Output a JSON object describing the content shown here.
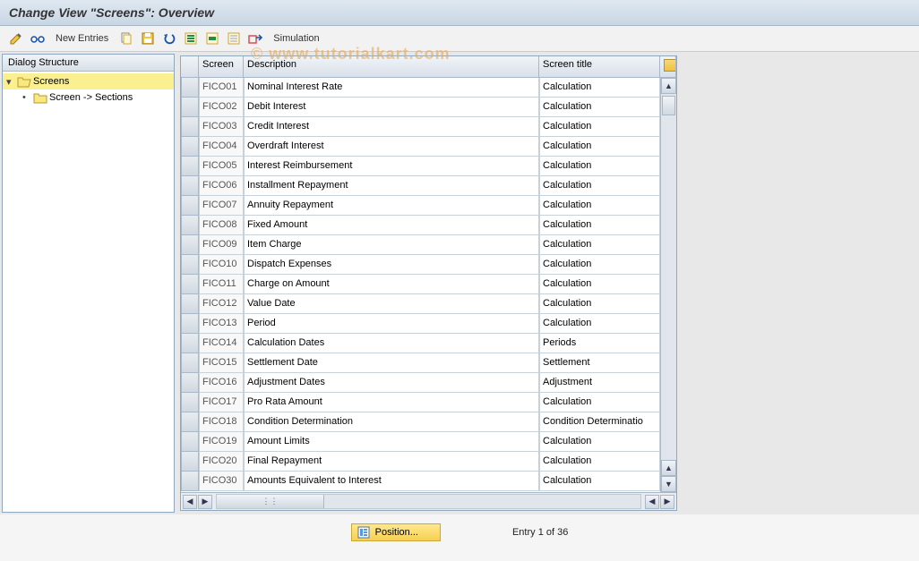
{
  "title": "Change View \"Screens\": Overview",
  "watermark": "© www.tutorialkart.com",
  "toolbar": {
    "new_entries": "New Entries",
    "simulation": "Simulation"
  },
  "sidebar": {
    "header": "Dialog Structure",
    "root": "Screens",
    "child": "Screen -> Sections"
  },
  "table": {
    "headers": {
      "screen": "Screen",
      "description": "Description",
      "title": "Screen title"
    },
    "rows": [
      {
        "screen": "FICO01",
        "desc": "Nominal Interest Rate",
        "title": "Calculation"
      },
      {
        "screen": "FICO02",
        "desc": "Debit Interest",
        "title": "Calculation"
      },
      {
        "screen": "FICO03",
        "desc": "Credit Interest",
        "title": "Calculation"
      },
      {
        "screen": "FICO04",
        "desc": "Overdraft Interest",
        "title": "Calculation"
      },
      {
        "screen": "FICO05",
        "desc": "Interest Reimbursement",
        "title": "Calculation"
      },
      {
        "screen": "FICO06",
        "desc": "Installment Repayment",
        "title": "Calculation"
      },
      {
        "screen": "FICO07",
        "desc": "Annuity Repayment",
        "title": "Calculation"
      },
      {
        "screen": "FICO08",
        "desc": "Fixed Amount",
        "title": "Calculation"
      },
      {
        "screen": "FICO09",
        "desc": "Item Charge",
        "title": "Calculation"
      },
      {
        "screen": "FICO10",
        "desc": "Dispatch Expenses",
        "title": "Calculation"
      },
      {
        "screen": "FICO11",
        "desc": "Charge on Amount",
        "title": "Calculation"
      },
      {
        "screen": "FICO12",
        "desc": "Value Date",
        "title": "Calculation"
      },
      {
        "screen": "FICO13",
        "desc": "Period",
        "title": "Calculation"
      },
      {
        "screen": "FICO14",
        "desc": "Calculation Dates",
        "title": "Periods"
      },
      {
        "screen": "FICO15",
        "desc": "Settlement Date",
        "title": "Settlement"
      },
      {
        "screen": "FICO16",
        "desc": "Adjustment Dates",
        "title": "Adjustment"
      },
      {
        "screen": "FICO17",
        "desc": "Pro Rata Amount",
        "title": "Calculation"
      },
      {
        "screen": "FICO18",
        "desc": "Condition Determination",
        "title": "Condition Determinatio"
      },
      {
        "screen": "FICO19",
        "desc": "Amount Limits",
        "title": "Calculation"
      },
      {
        "screen": "FICO20",
        "desc": "Final Repayment",
        "title": "Calculation"
      },
      {
        "screen": "FICO30",
        "desc": "Amounts Equivalent to Interest",
        "title": "Calculation"
      }
    ]
  },
  "footer": {
    "position_label": "Position...",
    "entry_text": "Entry 1 of 36"
  }
}
